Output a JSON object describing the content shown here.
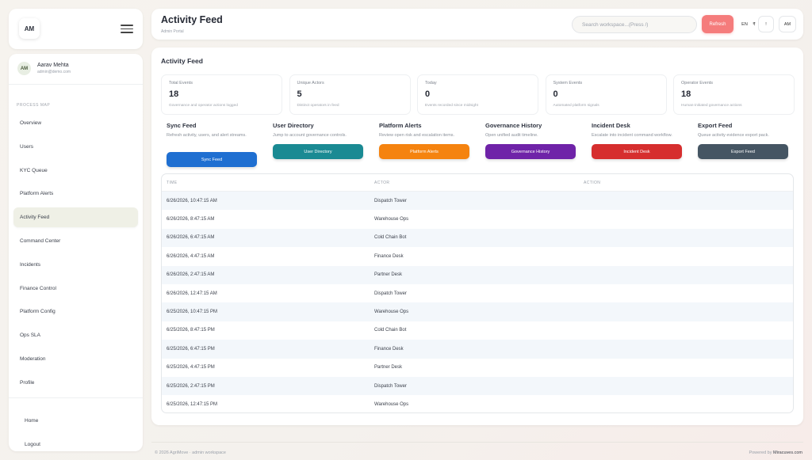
{
  "brand": {
    "logo": "AM",
    "menu_icon": "hamburger-icon"
  },
  "user": {
    "initials": "AM",
    "name": "Aarav Mehta",
    "email": "admin@demo.com"
  },
  "sidebar": {
    "section_label": "PROCESS MAP",
    "items": [
      {
        "label": "Overview"
      },
      {
        "label": "Users"
      },
      {
        "label": "KYC Queue"
      },
      {
        "label": "Platform Alerts"
      },
      {
        "label": "Activity Feed",
        "active": true
      },
      {
        "label": "Command Center"
      },
      {
        "label": "Incidents"
      },
      {
        "label": "Finance Control"
      },
      {
        "label": "Platform Config"
      },
      {
        "label": "Ops SLA"
      },
      {
        "label": "Moderation"
      },
      {
        "label": "Profile"
      }
    ],
    "bottom": [
      {
        "label": "Home"
      },
      {
        "label": "Logout"
      }
    ]
  },
  "header": {
    "title": "Activity Feed",
    "subtitle": "Admin Portal",
    "search_placeholder": "Search workspace...(Press /)",
    "refresh_label": "Refresh",
    "lang_label": "EN",
    "currency_label": "₹",
    "alert_label": "!",
    "avatar_label": "AM"
  },
  "main": {
    "title": "Activity Feed",
    "stats": [
      {
        "label": "Total Events",
        "value": "18",
        "desc": "Governance and operator actions logged"
      },
      {
        "label": "Unique Actors",
        "value": "5",
        "desc": "Distinct operators in feed"
      },
      {
        "label": "Today",
        "value": "0",
        "desc": "Events recorded since midnight"
      },
      {
        "label": "System Events",
        "value": "0",
        "desc": "Automated platform signals"
      },
      {
        "label": "Operator Events",
        "value": "18",
        "desc": "Human-initiated governance actions"
      }
    ],
    "actions": [
      {
        "title": "Sync Feed",
        "desc": "Refresh activity, users, and alert streams.",
        "button": "Sync Feed",
        "color": "#1f6fd1"
      },
      {
        "title": "User Directory",
        "desc": "Jump to account governance controls.",
        "button": "User Directory",
        "color": "#1a8a93"
      },
      {
        "title": "Platform Alerts",
        "desc": "Review open risk and escalation items.",
        "button": "Platform Alerts",
        "color": "#f5830f"
      },
      {
        "title": "Governance History",
        "desc": "Open unified audit timeline.",
        "button": "Governance History",
        "color": "#6f23a8"
      },
      {
        "title": "Incident Desk",
        "desc": "Escalate into incident command workflow.",
        "button": "Incident Desk",
        "color": "#d62e2e"
      },
      {
        "title": "Export Feed",
        "desc": "Queue activity evidence export pack.",
        "button": "Export Feed",
        "color": "#455563"
      }
    ],
    "table": {
      "columns": [
        "TIME",
        "ACTOR",
        "ACTION"
      ],
      "rows": [
        {
          "time": "6/26/2026, 10:47:15 AM",
          "actor": "Dispatch Tower",
          "action": ""
        },
        {
          "time": "6/26/2026, 8:47:15 AM",
          "actor": "Warehouse Ops",
          "action": ""
        },
        {
          "time": "6/26/2026, 6:47:15 AM",
          "actor": "Cold Chain Bot",
          "action": ""
        },
        {
          "time": "6/26/2026, 4:47:15 AM",
          "actor": "Finance Desk",
          "action": ""
        },
        {
          "time": "6/26/2026, 2:47:15 AM",
          "actor": "Partner Desk",
          "action": ""
        },
        {
          "time": "6/26/2026, 12:47:15 AM",
          "actor": "Dispatch Tower",
          "action": ""
        },
        {
          "time": "6/25/2026, 10:47:15 PM",
          "actor": "Warehouse Ops",
          "action": ""
        },
        {
          "time": "6/25/2026, 8:47:15 PM",
          "actor": "Cold Chain Bot",
          "action": ""
        },
        {
          "time": "6/25/2026, 6:47:15 PM",
          "actor": "Finance Desk",
          "action": ""
        },
        {
          "time": "6/25/2026, 4:47:15 PM",
          "actor": "Partner Desk",
          "action": ""
        },
        {
          "time": "6/25/2026, 2:47:15 PM",
          "actor": "Dispatch Tower",
          "action": ""
        },
        {
          "time": "6/25/2026, 12:47:15 PM",
          "actor": "Warehouse Ops",
          "action": ""
        }
      ]
    }
  },
  "footer": {
    "left": "© 2026 AgriMove · admin workspace",
    "right_prefix": "Powered by",
    "right_brand": "Miracuves.com"
  }
}
